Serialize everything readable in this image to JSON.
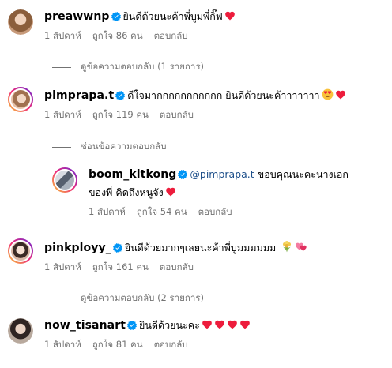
{
  "comments": [
    {
      "username": "preawwnp",
      "text": "ยินดีด้วยนะค้าพี่บูมพี่กิ๊ฟ",
      "time": "1 สัปดาห์",
      "likes": "ถูกใจ 86 คน",
      "reply": "ตอบกลับ",
      "hearts": 1,
      "avatar_color": "#c79a7a"
    },
    {
      "username": "pimprapa.t",
      "text": "ดีใจมากกกกกกกกกกก ยินดีด้วยนะค้าาาาาาา",
      "time": "1 สัปดาห์",
      "likes": "ถูกใจ 119 คน",
      "reply": "ตอบกลับ",
      "avatar_color": "#e7c3a8"
    },
    {
      "username": "boom_kitkong",
      "mention": "@pimprapa.t",
      "text": " ขอบคุณนะคะนางเอก",
      "text2": "ของพี่ คิดถึงหนูจัง",
      "time": "1 สัปดาห์",
      "likes": "ถูกใจ 54 คน",
      "reply": "ตอบกลับ",
      "avatar_color": "#8f9aa8"
    },
    {
      "username": "pinkployy_",
      "text": "ยินดีด้วยมากๆเลยนะค้าพี่บูมมมมมม",
      "time": "1 สัปดาห์",
      "likes": "ถูกใจ 161 คน",
      "reply": "ตอบกลับ",
      "avatar_color": "#d8b7a6"
    },
    {
      "username": "now_tisanart",
      "text": "ยินดีด้วยนะคะ",
      "time": "1 สัปดาห์",
      "likes": "ถูกใจ 81 คน",
      "reply": "ตอบกลับ",
      "hearts": 4,
      "avatar_color": "#b8a99d"
    }
  ],
  "threads": {
    "view_replies_1": "ดูข้อความตอบกลับ (1 รายการ)",
    "hide_replies": "ซ่อนข้อความตอบกลับ",
    "view_replies_2": "ดูข้อความตอบกลับ (2 รายการ)"
  },
  "colors": {
    "verified": "#0095f6",
    "heart": "#ed1c3c",
    "secondary_text": "#737373",
    "mention": "#1d4f8a"
  }
}
